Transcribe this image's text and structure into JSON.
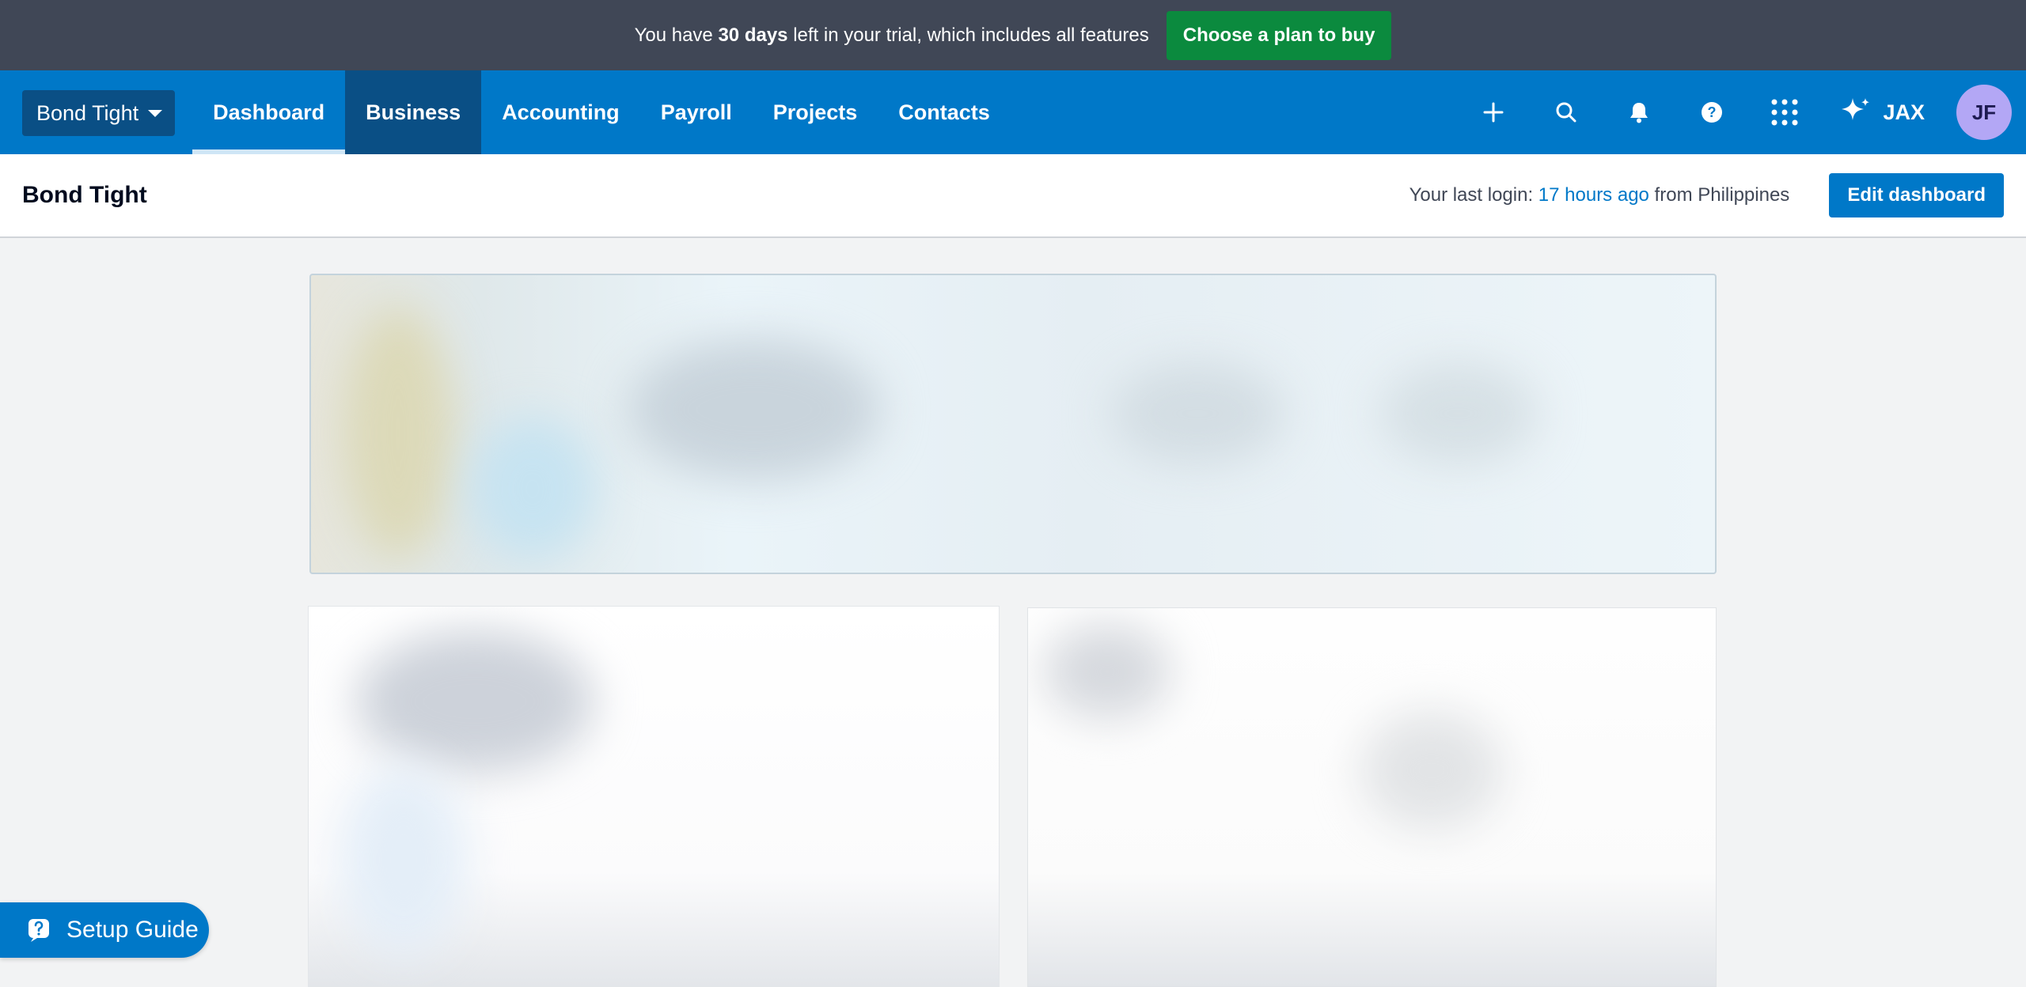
{
  "trial_banner": {
    "text_before": "You have ",
    "days": "30 days",
    "text_after": " left in your trial, which includes all features",
    "plan_button": "Choose a plan to buy"
  },
  "nav": {
    "org_name": "Bond Tight",
    "tabs": [
      {
        "label": "Dashboard"
      },
      {
        "label": "Business"
      },
      {
        "label": "Accounting"
      },
      {
        "label": "Payroll"
      },
      {
        "label": "Projects"
      },
      {
        "label": "Contacts"
      }
    ],
    "icons": [
      "plus-icon",
      "search-icon",
      "bell-icon",
      "help-icon",
      "app-grid-icon"
    ],
    "jax_label": "JAX",
    "avatar_initials": "JF"
  },
  "header": {
    "title": "Bond Tight",
    "last_login_label": "Your last login: ",
    "last_login_time": "17 hours ago",
    "last_login_location": " from Philippines",
    "edit_button": "Edit dashboard"
  },
  "setup_guide": {
    "label": "Setup Guide"
  },
  "colors": {
    "banner_bg": "#404756",
    "plan_button": "#0b8a3e",
    "nav_bg": "#0078c8",
    "nav_selected": "#0a4f85",
    "page_bg": "#f2f3f4",
    "avatar_bg": "#b3a7f5"
  }
}
